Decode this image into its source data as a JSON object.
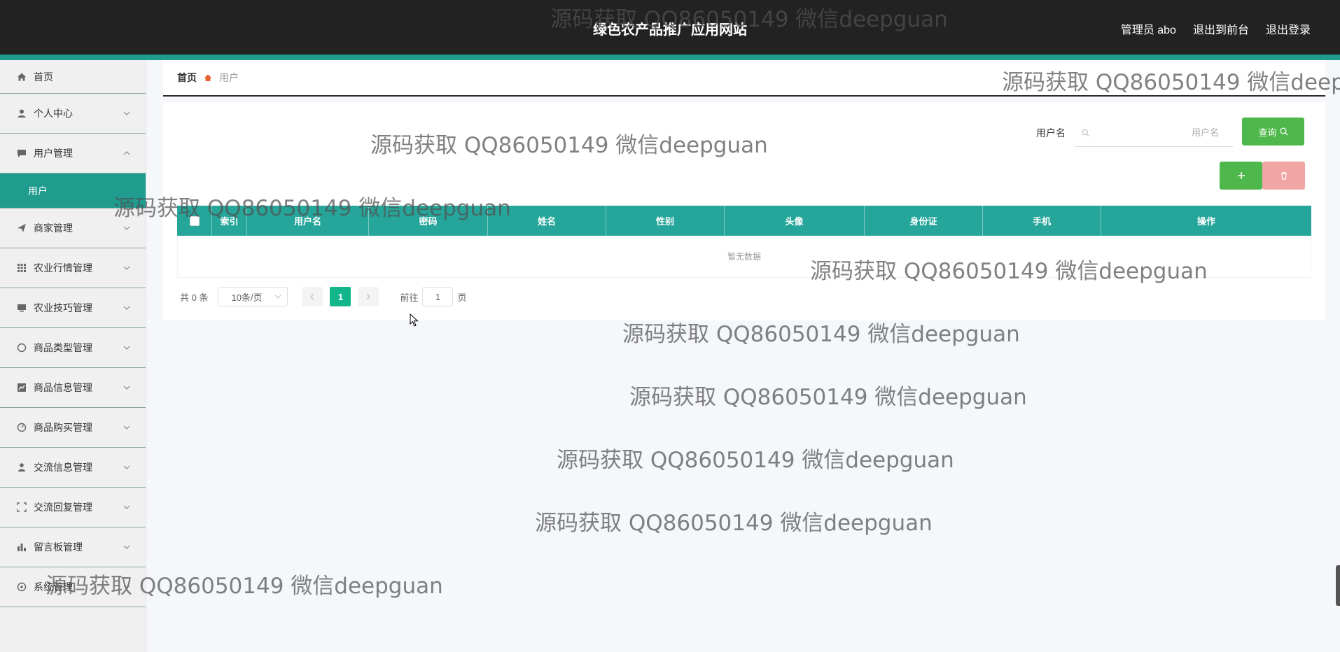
{
  "header": {
    "title": "绿色农产品推广应用网站",
    "admin_label": "管理员 abo",
    "front_label": "退出到前台",
    "logout_label": "退出登录"
  },
  "sidebar": {
    "items": [
      {
        "label": "首页",
        "icon": "home-icon"
      },
      {
        "label": "个人中心",
        "icon": "user-icon"
      },
      {
        "label": "用户管理",
        "icon": "chat-icon",
        "expanded": true,
        "sub": [
          {
            "label": "用户",
            "active": true
          }
        ]
      },
      {
        "label": "商家管理",
        "icon": "send-icon"
      },
      {
        "label": "农业行情管理",
        "icon": "grid-icon"
      },
      {
        "label": "农业技巧管理",
        "icon": "monitor-icon"
      },
      {
        "label": "商品类型管理",
        "icon": "compass-icon"
      },
      {
        "label": "商品信息管理",
        "icon": "chart-icon"
      },
      {
        "label": "商品购买管理",
        "icon": "gauge-icon"
      },
      {
        "label": "交流信息管理",
        "icon": "person-icon"
      },
      {
        "label": "交流回复管理",
        "icon": "frame-icon"
      },
      {
        "label": "留言板管理",
        "icon": "bars-icon"
      },
      {
        "label": "系统管理",
        "icon": "settings-icon"
      }
    ]
  },
  "breadcrumb": {
    "home": "首页",
    "current": "用户"
  },
  "search": {
    "label": "用户名",
    "placeholder": "用户名",
    "query_button": "查询"
  },
  "table": {
    "columns": [
      "索引",
      "用户名",
      "密码",
      "姓名",
      "性别",
      "头像",
      "身份证",
      "手机",
      "操作"
    ],
    "empty_text": "暂无数据"
  },
  "pager": {
    "total": "共 0 条",
    "page_size": "10条/页",
    "current_page": "1",
    "goto_label": "前往",
    "goto_value": "1",
    "page_suffix": "页"
  },
  "watermark": "源码获取 QQ86050149 微信deepguan",
  "colors": {
    "accent": "#1f9c8e",
    "table_header": "#26a69a",
    "primary_button": "#4fb84c",
    "danger_button": "#f2a5a5",
    "page_active": "#13b68a"
  }
}
